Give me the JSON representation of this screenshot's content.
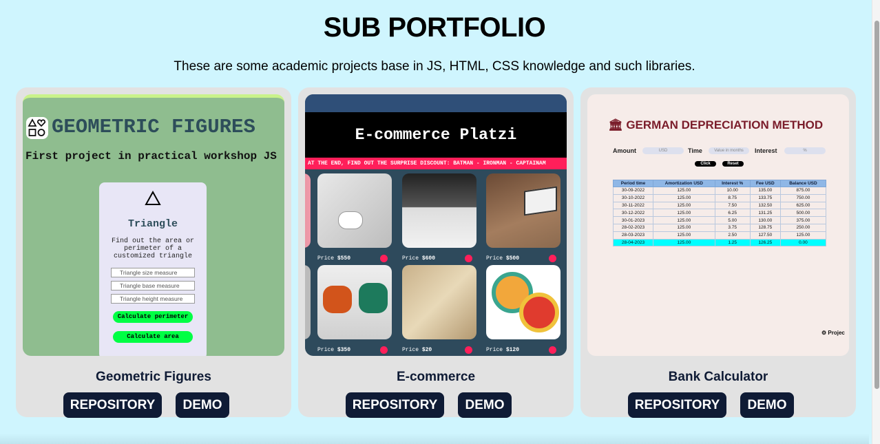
{
  "header": {
    "title": "SUB PORTFOLIO",
    "subtitle": "These are some academic projects base in JS, HTML, CSS knowledge and such libraries."
  },
  "projects": [
    {
      "name": "Geometric Figures",
      "repo_label": "REPOSITORY",
      "demo_label": "DEMO",
      "preview": {
        "heading": "GEOMETRIC FIGURES",
        "subheading": "First project in practical workshop JS",
        "panel_title": "Triangle",
        "panel_desc": "Find out the area or perimeter of a customized triangle",
        "inputs": [
          "Triangle size measure",
          "Triangle base measure",
          "Triangle height measure"
        ],
        "buttons": [
          "Calculate perimeter",
          "Calculate area"
        ]
      }
    },
    {
      "name": "E-commerce",
      "repo_label": "REPOSITORY",
      "demo_label": "DEMO",
      "preview": {
        "heading": "E-commerce Platzi",
        "marquee": "AT THE END, FIND OUT THE SURPRISE DISCOUNT: BATMAN - IRONMAN - CAPTAINAM",
        "price_label": "Price",
        "prices": [
          "$550",
          "$600",
          "$500",
          "$350",
          "$20",
          "$120"
        ]
      }
    },
    {
      "name": "Bank Calculator",
      "repo_label": "REPOSITORY",
      "demo_label": "DEMO",
      "preview": {
        "heading": "GERMAN DEPRECIATION METHOD",
        "amount_label": "Amount",
        "amount_placeholder": "USD",
        "time_label": "Time",
        "time_placeholder": "Value in months",
        "interest_label": "Interest",
        "interest_placeholder": "%",
        "click_label": "Click",
        "reset_label": "Reset",
        "columns": [
          "Period time",
          "Amortization USD",
          "Interest %",
          "Fee USD",
          "Balance USD"
        ],
        "rows": [
          [
            "30-09-2022",
            "125.00",
            "10.00",
            "135.00",
            "875.00"
          ],
          [
            "30-10-2022",
            "125.00",
            "8.75",
            "133.75",
            "750.00"
          ],
          [
            "30-11-2022",
            "125.00",
            "7.50",
            "132.50",
            "625.00"
          ],
          [
            "30-12-2022",
            "125.00",
            "6.25",
            "131.25",
            "500.00"
          ],
          [
            "30-01-2023",
            "125.00",
            "5.00",
            "130.00",
            "375.00"
          ],
          [
            "28-02-2023",
            "125.00",
            "3.75",
            "128.75",
            "250.00"
          ],
          [
            "28-03-2023",
            "125.00",
            "2.50",
            "127.50",
            "125.00"
          ],
          [
            "28-04-2023",
            "125.00",
            "1.25",
            "126.25",
            "0.00"
          ]
        ],
        "footer": "Projec"
      }
    }
  ]
}
